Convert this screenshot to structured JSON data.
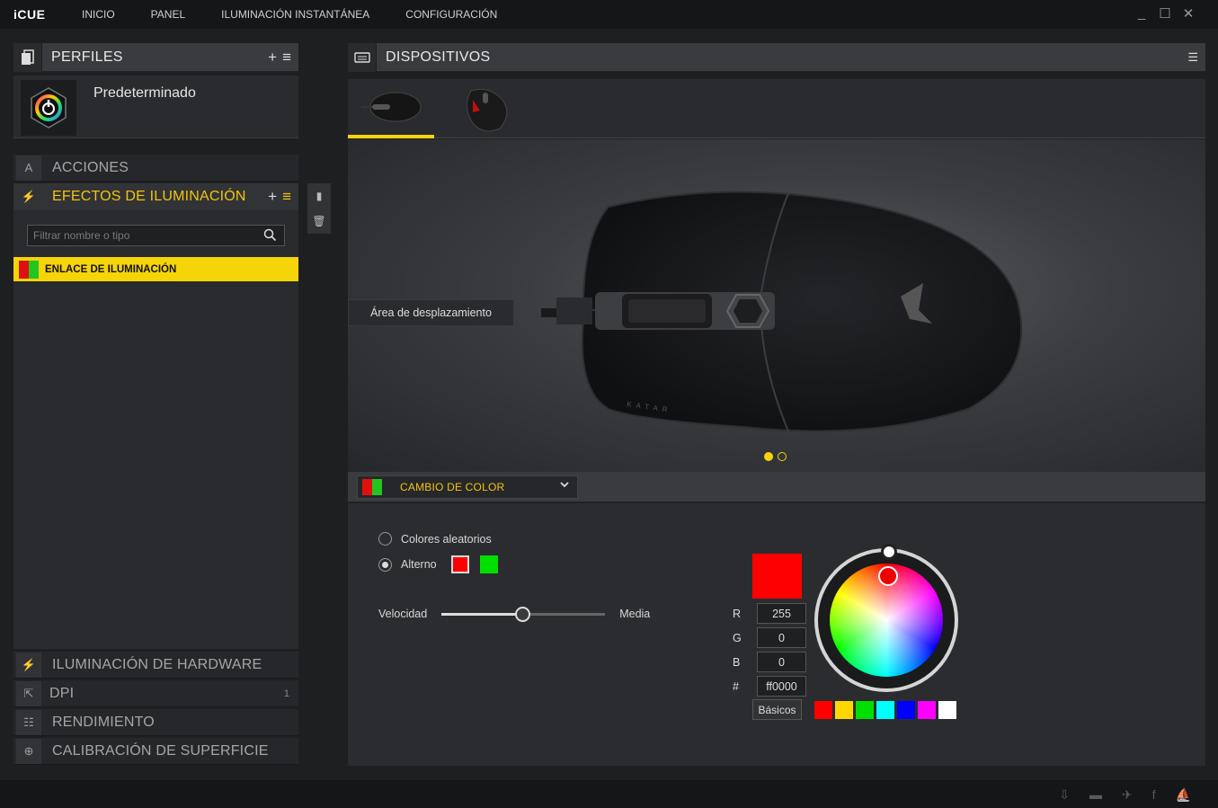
{
  "app": {
    "name": "iCUE"
  },
  "nav": {
    "items": [
      "INICIO",
      "PANEL",
      "ILUMINACIÓN INSTANTÁNEA",
      "CONFIGURACIÓN"
    ]
  },
  "window": {
    "min": "_",
    "max": "☐",
    "close": "✕"
  },
  "profiles": {
    "title": "PERFILES",
    "add": "+",
    "menu": "≡",
    "current": "Predeterminado"
  },
  "sections": {
    "actions": "ACCIONES",
    "effects": "EFECTOS DE ILUMINACIÓN",
    "effects_add": "+",
    "effects_menu": "≡",
    "hardware": "ILUMINACIÓN DE HARDWARE",
    "dpi": "DPI",
    "dpi_count": "1",
    "performance": "RENDIMIENTO",
    "calibration": "CALIBRACIÓN DE SUPERFICIE"
  },
  "filter": {
    "placeholder": "Filtrar nombre o tipo"
  },
  "effects_list": [
    {
      "label": "ENLACE DE ILUMINACIÓN",
      "colors": [
        "#e01010",
        "#23c61e"
      ]
    }
  ],
  "devices": {
    "title": "DISPOSITIVOS",
    "menu": "☰",
    "scroll_area_label": "Área de desplazamiento",
    "pages": 2,
    "current_page": 1
  },
  "effect_selector": {
    "value": "CAMBIO DE COLOR",
    "colors": [
      "#e01010",
      "#23c61e"
    ]
  },
  "options": {
    "random_colors": "Colores aleatorios",
    "alternate": "Alterno",
    "alternate_selected": true,
    "alternate_colors": [
      "#ff0000",
      "#00ff00"
    ],
    "speed_label": "Velocidad",
    "speed_value": "Media",
    "speed_level": 0.5
  },
  "color": {
    "current": "#ff0000",
    "r_label": "R",
    "r": "255",
    "g_label": "G",
    "g": "0",
    "b_label": "B",
    "b": "0",
    "hex_label": "#",
    "hex": "ff0000",
    "basic_button": "Básicos",
    "palette": [
      "#ff0000",
      "#ffd700",
      "#00e000",
      "#00ffff",
      "#0000ff",
      "#ff00ff",
      "#ffffff"
    ]
  }
}
